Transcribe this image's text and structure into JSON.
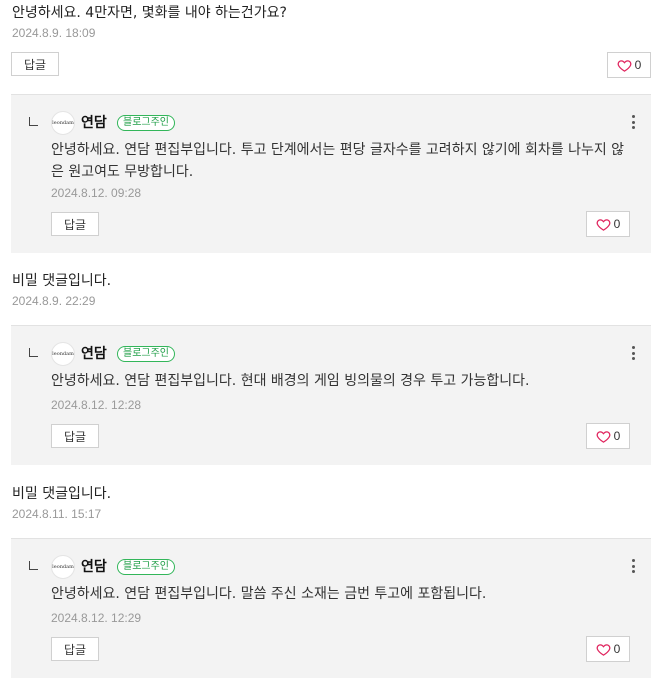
{
  "comments": [
    {
      "text": "안녕하세요. 4만자면, 몇화를 내야 하는건가요?",
      "date": "2024.8.9. 18:09",
      "reply_label": "답글",
      "like_count": "0",
      "replies": [
        {
          "author": "연담",
          "badge": "블로그주인",
          "avatar_text": "leondam",
          "text": "안녕하세요. 연담 편집부입니다. 투고 단계에서는 편당 글자수를 고려하지 않기에 회차를 나누지 않은 원고여도 무방합니다.",
          "date": "2024.8.12. 09:28",
          "reply_label": "답글",
          "like_count": "0"
        }
      ]
    },
    {
      "text": "비밀 댓글입니다.",
      "date": "2024.8.9. 22:29",
      "replies": [
        {
          "author": "연담",
          "badge": "블로그주인",
          "avatar_text": "leondam",
          "text": "안녕하세요. 연담 편집부입니다. 현대 배경의 게임 빙의물의 경우 투고 가능합니다.",
          "date": "2024.8.12. 12:28",
          "reply_label": "답글",
          "like_count": "0"
        }
      ]
    },
    {
      "text": "비밀 댓글입니다.",
      "date": "2024.8.11. 15:17",
      "replies": [
        {
          "author": "연담",
          "badge": "블로그주인",
          "avatar_text": "leondam",
          "text": "안녕하세요. 연담 편집부입니다. 말씀 주신 소재는 금번 투고에 포함됩니다.",
          "date": "2024.8.12. 12:29",
          "reply_label": "답글",
          "like_count": "0"
        }
      ]
    }
  ],
  "colors": {
    "heart": "#e0245e",
    "badge_border": "#33b65a",
    "reply_bg": "#f3f3f3"
  },
  "icons": {
    "heart": "heart-outline-icon",
    "more": "vertical-dots-icon",
    "reply_tree": "reply-tree-icon"
  }
}
